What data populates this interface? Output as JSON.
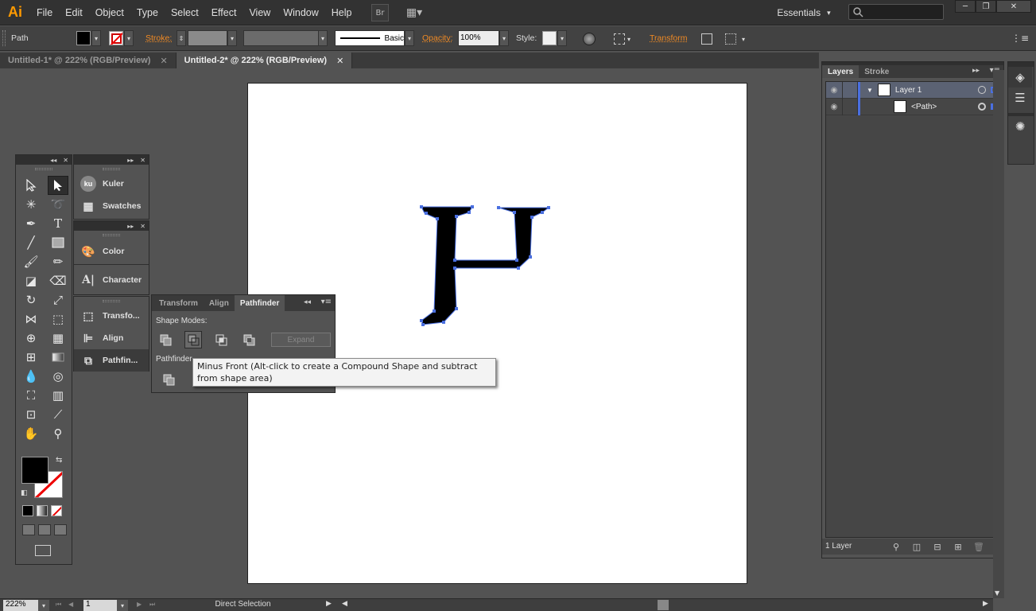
{
  "app": {
    "logo": "Ai"
  },
  "menus": [
    "File",
    "Edit",
    "Object",
    "Type",
    "Select",
    "Effect",
    "View",
    "Window",
    "Help"
  ],
  "menubar_buttons": {
    "bridge": "Br",
    "arrange": "▦▾"
  },
  "workspace": {
    "label": "Essentials",
    "caret": "▾"
  },
  "window_controls": {
    "minimize": "─",
    "restore": "❐",
    "close": "✕"
  },
  "control": {
    "object_type": "Path",
    "stroke_label": "Stroke:",
    "stroke_profile": "Basic",
    "opacity_label": "Opacity:",
    "opacity_value": "100%",
    "style_label": "Style:",
    "transform_label": "Transform"
  },
  "tabs": [
    {
      "label": "Untitled-1* @ 222% (RGB/Preview)",
      "close": "✕"
    },
    {
      "label": "Untitled-2* @ 222% (RGB/Preview)",
      "close": "✕"
    }
  ],
  "dock": {
    "group1": [
      {
        "label": "Kuler",
        "icon_text": "ku"
      },
      {
        "label": "Swatches",
        "icon": "grid-icon"
      }
    ],
    "group2": [
      {
        "label": "Color",
        "icon": "palette-icon"
      },
      {
        "label": "Character",
        "icon": "character-icon"
      }
    ],
    "group3": [
      {
        "label": "Transfo...",
        "icon": "transform-icon"
      },
      {
        "label": "Align",
        "icon": "align-icon"
      },
      {
        "label": "Pathfin...",
        "icon": "pathfinder-icon"
      }
    ]
  },
  "pathfinder_panel": {
    "tabs": [
      "Transform",
      "Align",
      "Pathfinder"
    ],
    "active_tab": "Pathfinder",
    "shape_modes_label": "Shape Modes:",
    "pathfinders_label": "Pathfinder",
    "expand_label": "Expand"
  },
  "tooltip": {
    "text": "Minus Front (Alt-click to create a Compound Shape and subtract from shape area)"
  },
  "layers_panel": {
    "tabs": [
      "Layers",
      "Stroke"
    ],
    "active_tab": "Layers",
    "rows": [
      {
        "name": "Layer 1",
        "expand": "▼"
      },
      {
        "name": "<Path>"
      }
    ],
    "count_label": "1 Layer"
  },
  "status": {
    "zoom": "222%",
    "artboard_num": "1",
    "tool": "Direct Selection"
  },
  "colors": {
    "selection": "#4a6fe0",
    "accent": "#f08a24",
    "fill": "#000000"
  }
}
